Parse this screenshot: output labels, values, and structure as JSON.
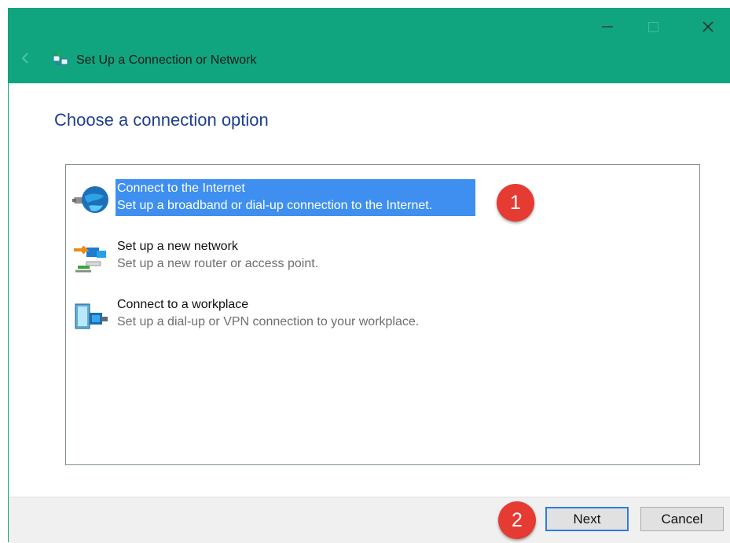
{
  "window": {
    "title": "Set Up a Connection or Network",
    "controls": [
      "minimize",
      "maximize",
      "close"
    ],
    "accent_color": "#11a57f"
  },
  "page": {
    "heading": "Choose a connection option"
  },
  "options": [
    {
      "title": "Connect to the Internet",
      "description": "Set up a broadband or dial-up connection to the Internet.",
      "icon": "globe-icon",
      "selected": true
    },
    {
      "title": "Set up a new network",
      "description": "Set up a new router or access point.",
      "icon": "network-icon",
      "selected": false
    },
    {
      "title": "Connect to a workplace",
      "description": "Set up a dial-up or VPN connection to your workplace.",
      "icon": "workplace-icon",
      "selected": false
    }
  ],
  "buttons": {
    "next": "Next",
    "cancel": "Cancel"
  },
  "annotations": {
    "badge_one": "1",
    "badge_two": "2"
  },
  "colors": {
    "selection": "#3e8ff0",
    "badge": "#e53b32",
    "heading": "#1f3f8f"
  }
}
